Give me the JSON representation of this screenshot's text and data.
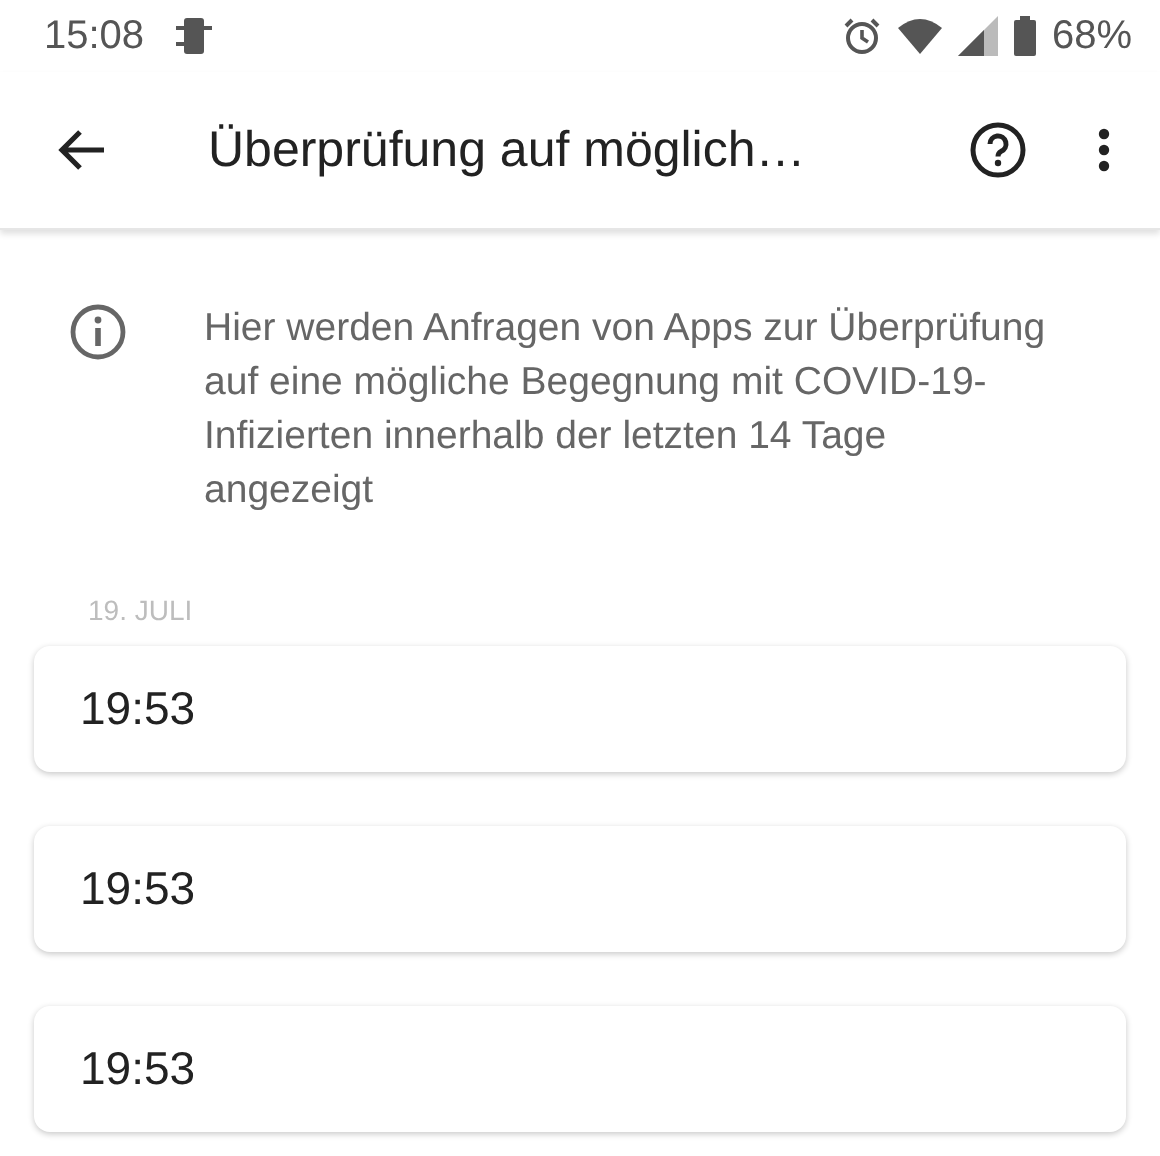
{
  "status_bar": {
    "time": "15:08",
    "battery": "68%"
  },
  "app_bar": {
    "title": "Überprüfung auf möglich…"
  },
  "info": {
    "text": "Hier werden Anfragen von Apps zur Überprüfung auf eine mögliche Begegnung mit COVID-19-Infizierten innerhalb der letzten 14 Tage angezeigt"
  },
  "sections": [
    {
      "date": "19. JULI",
      "entries": [
        {
          "time": "19:53"
        },
        {
          "time": "19:53"
        },
        {
          "time": "19:53"
        }
      ]
    }
  ]
}
